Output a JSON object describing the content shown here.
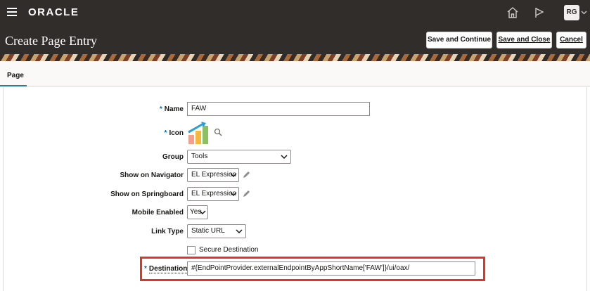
{
  "header": {
    "brand": "ORACLE",
    "avatar_initials": "RG"
  },
  "titlebar": {
    "title": "Create Page Entry",
    "save_continue_label": "Save and Continue",
    "save_close_label": "Save and Close",
    "cancel_label": "Cancel"
  },
  "tabs": [
    {
      "label": "Page"
    }
  ],
  "form": {
    "name": {
      "label": "Name",
      "required": "*",
      "value": "FAW"
    },
    "icon": {
      "label": "Icon",
      "required": "*"
    },
    "group": {
      "label": "Group",
      "value": "Tools"
    },
    "show_on_navigator": {
      "label": "Show on Navigator",
      "value": "EL Expression"
    },
    "show_on_springboard": {
      "label": "Show on Springboard",
      "value": "EL Expression"
    },
    "mobile_enabled": {
      "label": "Mobile Enabled",
      "value": "Yes"
    },
    "link_type": {
      "label": "Link Type",
      "value": "Static URL"
    },
    "secure_destination": {
      "label": "Secure Destination",
      "checked": false
    },
    "destination": {
      "label": "Destination",
      "required": "*",
      "value": "#{EndPointProvider.externalEndpointByAppShortName['FAW']}/ui/oax/"
    }
  },
  "colors": {
    "header_bg": "#312d2a",
    "accent": "#227e9e",
    "highlight": "#e8321c"
  }
}
